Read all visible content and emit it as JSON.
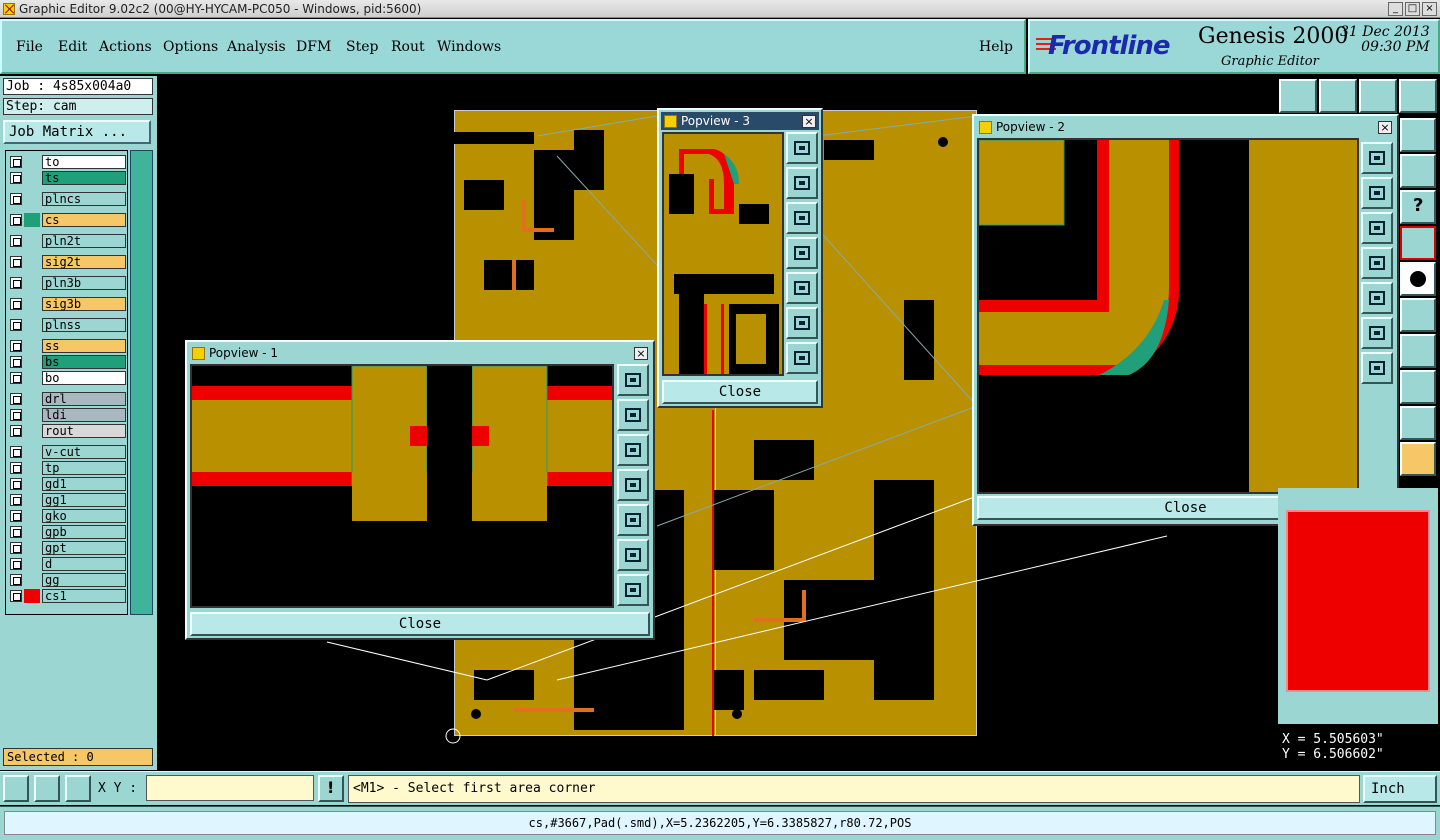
{
  "window": {
    "title": "Graphic Editor 9.02c2 (00@HY-HYCAM-PC050 - Windows, pid:5600)",
    "min": "_",
    "max": "□",
    "close": "×"
  },
  "menu": {
    "file": "File",
    "edit": "Edit",
    "actions": "Actions",
    "options": "Options",
    "analysis": "Analysis",
    "dfm": "DFM",
    "step": "Step",
    "rout": "Rout",
    "windows": "Windows",
    "help": "Help"
  },
  "brand": {
    "logo": "Frontline",
    "product": "Genesis 2000",
    "subtitle": "Graphic Editor",
    "date": "31 Dec 2013",
    "time": "09:30 PM"
  },
  "job": {
    "job": "Job : 4s85x004a0",
    "step": "Step: cam",
    "matrix_button": "Job Matrix ..."
  },
  "layers": [
    {
      "name": "to",
      "color": "#ffffff"
    },
    {
      "name": "ts",
      "color": "#1fa07a"
    },
    {
      "name": "plncs",
      "color": "#9cd6d2"
    },
    {
      "name": "cs",
      "color": "#f5c766"
    },
    {
      "name": "pln2t",
      "color": "#9cd6d2"
    },
    {
      "name": "sig2t",
      "color": "#f5c766"
    },
    {
      "name": "pln3b",
      "color": "#9cd6d2"
    },
    {
      "name": "sig3b",
      "color": "#f5c766"
    },
    {
      "name": "plnss",
      "color": "#9cd6d2"
    },
    {
      "name": "ss",
      "color": "#f5c766"
    },
    {
      "name": "bs",
      "color": "#1fa07a"
    },
    {
      "name": "bo",
      "color": "#ffffff"
    },
    {
      "name": "drl",
      "color": "#a8b8c0"
    },
    {
      "name": "ldi",
      "color": "#a8b8c0"
    },
    {
      "name": "rout",
      "color": "#d8d8d8"
    },
    {
      "name": "v-cut",
      "color": "#9cd6d2"
    },
    {
      "name": "tp",
      "color": "#9cd6d2"
    },
    {
      "name": "gd1",
      "color": "#9cd6d2"
    },
    {
      "name": "gg1",
      "color": "#9cd6d2"
    },
    {
      "name": "gko",
      "color": "#9cd6d2"
    },
    {
      "name": "gpb",
      "color": "#9cd6d2"
    },
    {
      "name": "gpt",
      "color": "#9cd6d2"
    },
    {
      "name": "d",
      "color": "#9cd6d2"
    },
    {
      "name": "gg",
      "color": "#9cd6d2"
    },
    {
      "name": "cs1",
      "color": "#9cd6d2"
    }
  ],
  "selected": "Selected : 0",
  "popviews": {
    "p1": "Popview - 1",
    "p2": "Popview - 2",
    "p3": "Popview - 3",
    "close": "Close"
  },
  "coords": {
    "x": "X = 5.505603\"",
    "y": "Y = 6.506602\""
  },
  "bottom": {
    "xy_label": "X Y :",
    "prompt": "<M1> - Select first area corner",
    "unit": "Inch"
  },
  "status": "cs,#3667,Pad(.smd),X=5.2362205,Y=6.3385827,r80.72,POS",
  "colors": {
    "board": "#b89000",
    "copper_red": "#ff0000",
    "panel": "#9cd6d2",
    "accent": "#1b2aa8"
  }
}
